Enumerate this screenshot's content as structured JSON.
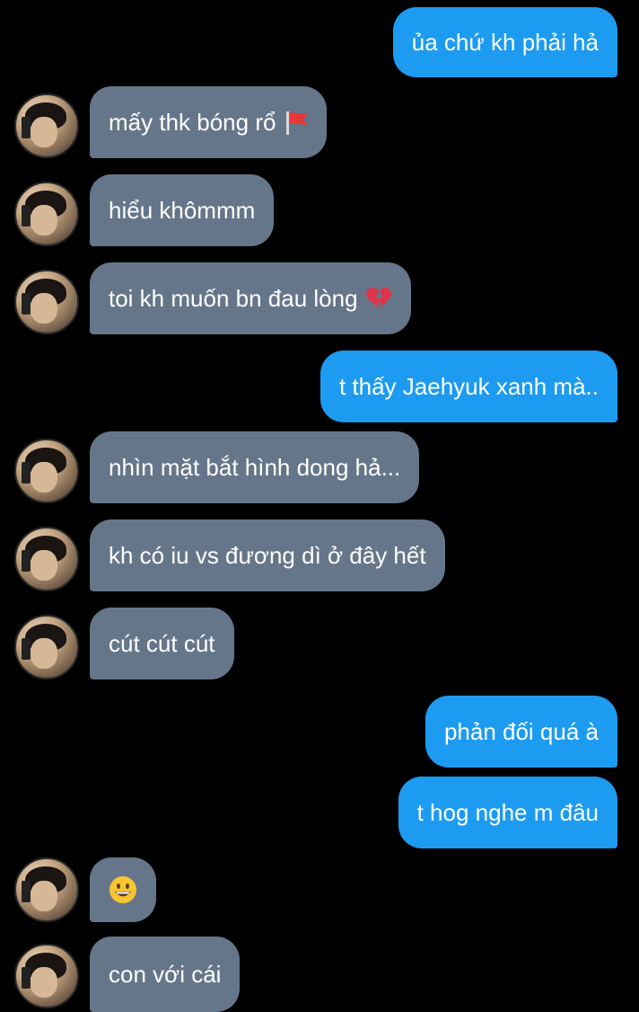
{
  "messages": [
    {
      "side": "sent",
      "text": "ủa chứ kh phải hả"
    },
    {
      "side": "received",
      "text": "mấy thk bóng rổ",
      "icon": "red-flag-icon"
    },
    {
      "side": "received",
      "text": "hiểu khômmm"
    },
    {
      "side": "received",
      "text": "toi kh muốn bn đau lòng",
      "icon": "broken-heart-icon"
    },
    {
      "side": "sent",
      "text": "t thấy Jaehyuk xanh mà.."
    },
    {
      "side": "received",
      "text": "nhìn mặt bắt hình dong hả..."
    },
    {
      "side": "received",
      "text": "kh có iu vs đương dì ở đây hết"
    },
    {
      "side": "received",
      "text": "cút cút cút"
    },
    {
      "side": "sent",
      "text": "phản đối quá à"
    },
    {
      "side": "sent",
      "text": "t hog nghe m đâu"
    },
    {
      "side": "received",
      "text": "",
      "icon": "grinning-face-icon"
    },
    {
      "side": "received",
      "text": "con với cái"
    }
  ],
  "colors": {
    "background": "#000000",
    "sent_bubble": "#1d9bf0",
    "received_bubble": "#66768a",
    "text": "#ffffff"
  }
}
